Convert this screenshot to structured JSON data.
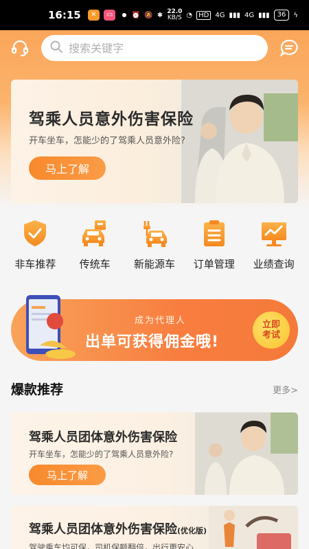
{
  "status_bar": {
    "time": "16:15",
    "net_speed": "22.0",
    "net_unit": "KB/S",
    "hd": "HD",
    "signal1": "4G",
    "signal2": "4G",
    "battery": "36"
  },
  "header": {
    "search_placeholder": "搜索关键字"
  },
  "banner": {
    "title": "驾乘人员意外伤害保险",
    "subtitle": "开车坐车，怎能少的了驾乘人员意外险?",
    "button": "马上了解"
  },
  "categories": [
    {
      "label": "非车推荐",
      "icon": "shield-check-icon"
    },
    {
      "label": "传统车",
      "icon": "car-icon"
    },
    {
      "label": "新能源车",
      "icon": "ev-car-icon"
    },
    {
      "label": "订单管理",
      "icon": "clipboard-icon"
    },
    {
      "label": "业绩查询",
      "icon": "chart-monitor-icon"
    }
  ],
  "promo": {
    "small": "成为代理人",
    "big": "出单可获得佣金哦!",
    "cta": "立即考试"
  },
  "section": {
    "title": "爆款推荐",
    "more": "更多>"
  },
  "products": [
    {
      "title": "驾乘人员团体意外伤害保险",
      "desc": "开车坐车，怎能少的了驾乘人员意外险?",
      "button": "马上了解"
    },
    {
      "title": "驾乘人员团体意外伤害保险",
      "suffix": "(优化版)",
      "desc": "驾驶乘车均可保，司机保额翻倍，出行更安心"
    }
  ],
  "colors": {
    "accent": "#f7892d",
    "header_bg": "#fba65a",
    "icon_gradient_top": "#fbb24a",
    "icon_gradient_bottom": "#f58a1f"
  }
}
